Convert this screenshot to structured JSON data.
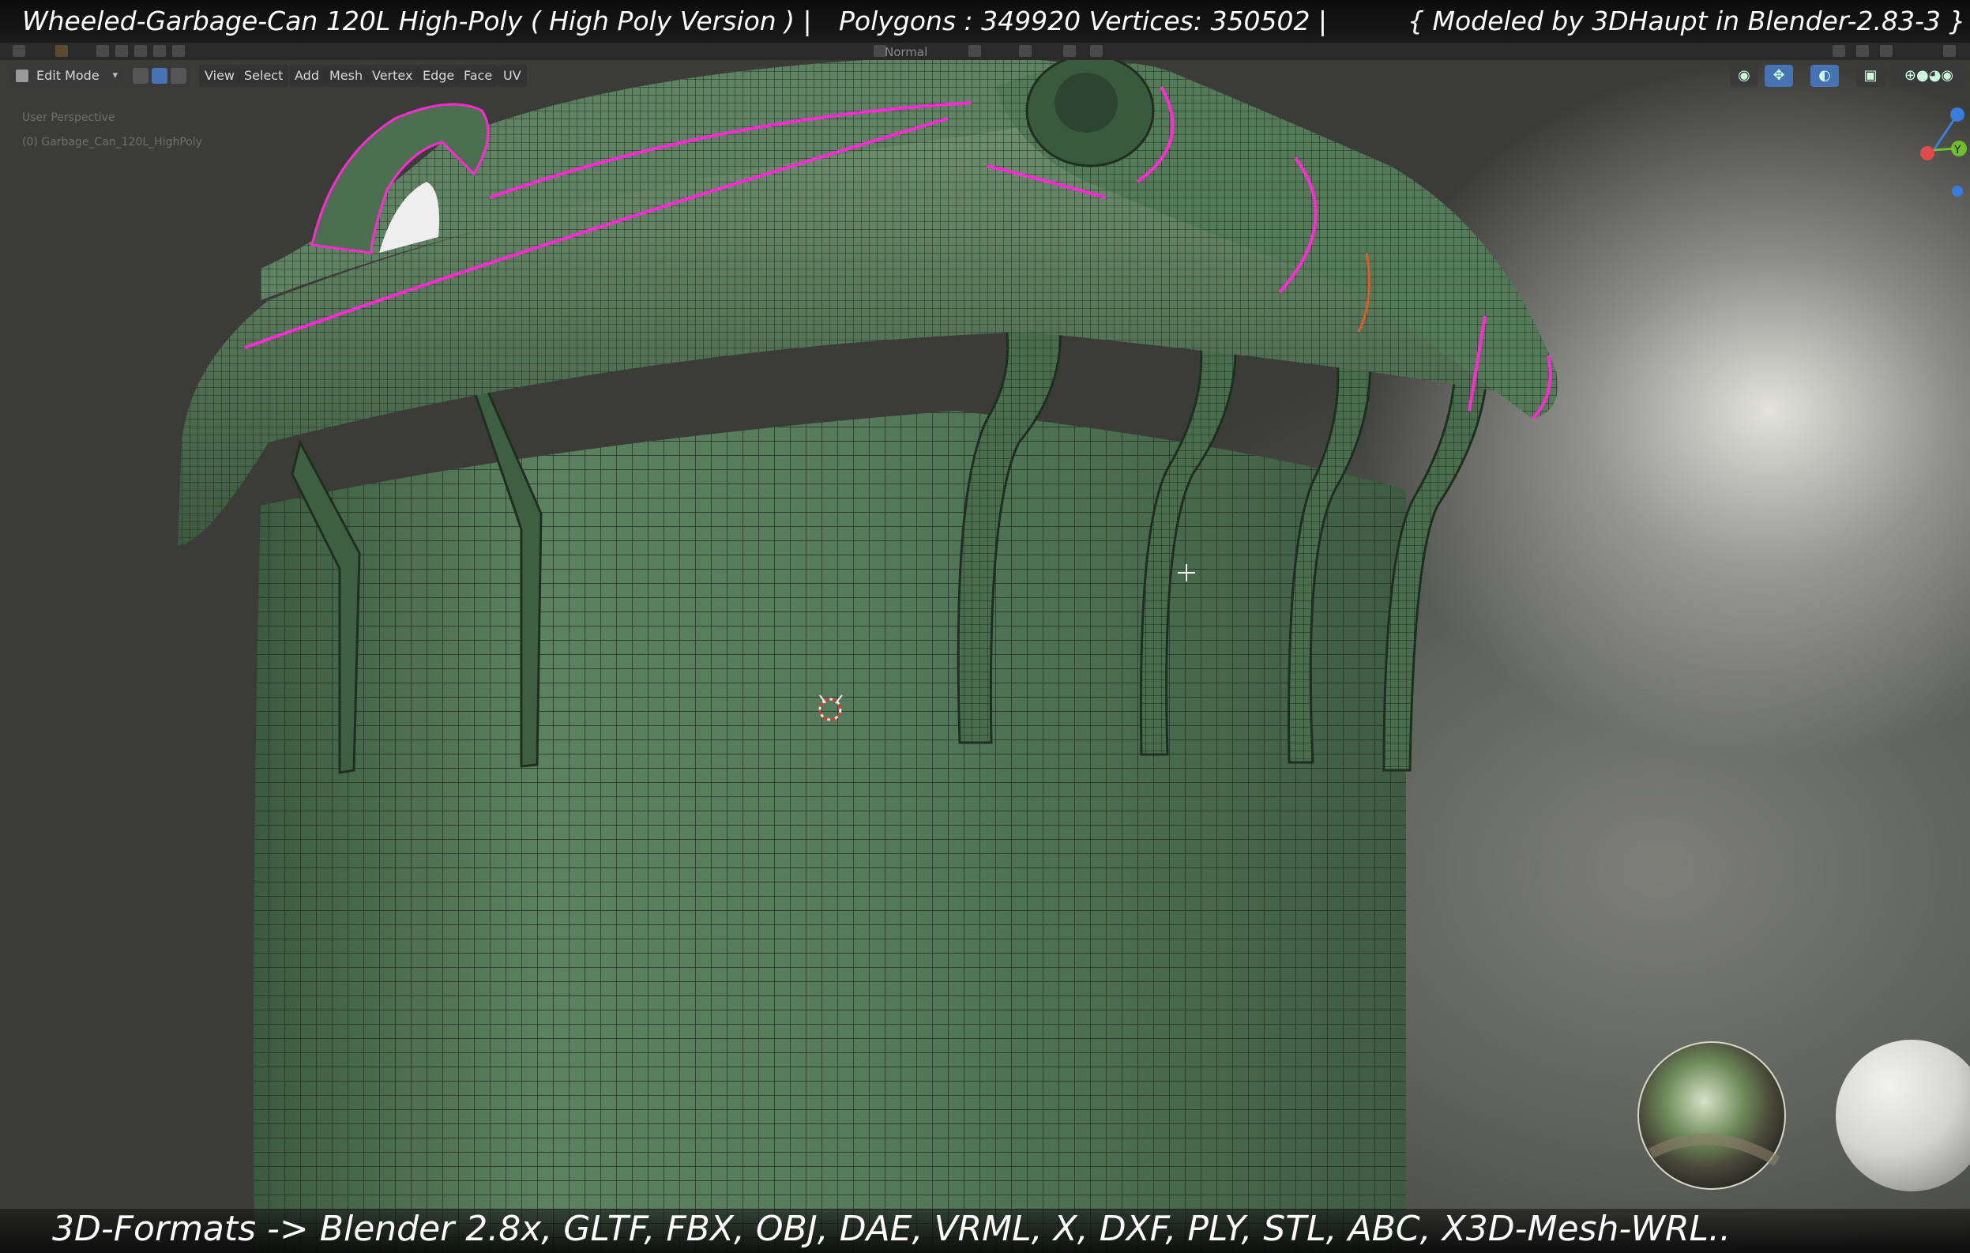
{
  "title_bar": {
    "left": "Wheeled-Garbage-Can 120L High-Poly ( High Poly Version )  |",
    "middle": "Polygons : 349920   Vertices: 350502     |",
    "right": "{ Modeled by 3DHaupt in Blender-2.83-3 }"
  },
  "header": {
    "orientation": "Normal"
  },
  "viewport_header": {
    "mode": "Edit Mode",
    "menus": [
      "View",
      "Select",
      "Add",
      "Mesh",
      "Vertex",
      "Edge",
      "Face",
      "UV"
    ]
  },
  "overlay": {
    "perspective": "User Perspective",
    "object": "(0) Garbage_Can_120L_HighPoly"
  },
  "gizmo": {
    "y_axis": "Y",
    "colors": {
      "x": "#e04a4a",
      "y": "#6fbf2a",
      "z": "#3b7ddd"
    }
  },
  "formats_bar": {
    "text": "3D-Formats -> Blender 2.8x, GLTF, FBX, OBJ, DAE, VRML, X, DXF, PLY, STL, ABC, X3D-Mesh-WRL.."
  },
  "icons": [
    "cursor-icon",
    "3d-cursor-icon",
    "lookdev-hdri-sphere-icon",
    "lookdev-white-sphere-icon",
    "navigation-gizmo-icon"
  ],
  "colors": {
    "mesh": "#4f7252",
    "seam": "#ff2ad4",
    "title_bg": "#0c0c0c"
  }
}
